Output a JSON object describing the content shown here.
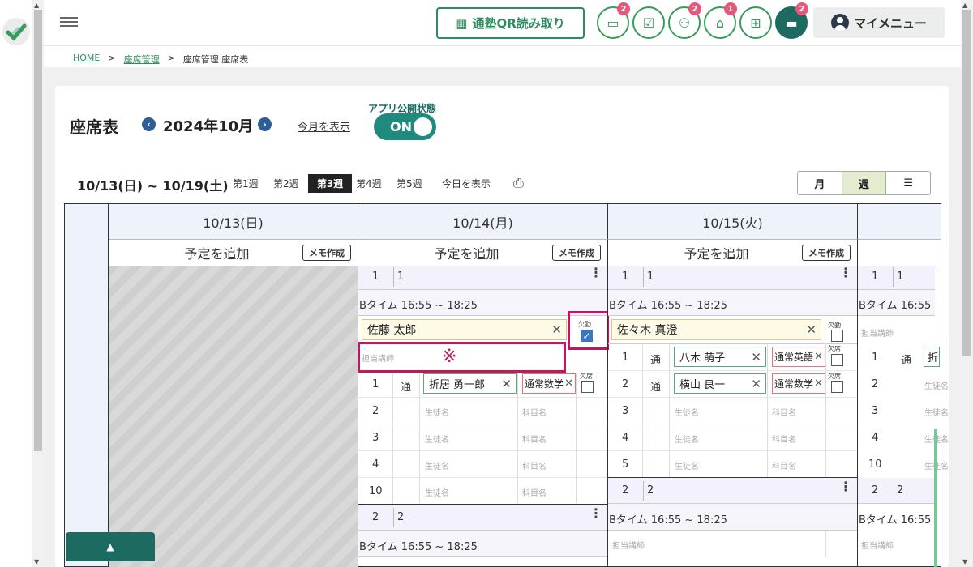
{
  "header": {
    "qr_label": "通塾QR読み取り",
    "mymenu_label": "マイメニュー",
    "badges": {
      "messages": "2",
      "students": "2",
      "school": "1",
      "chat": "2"
    }
  },
  "breadcrumb": {
    "home": "HOME",
    "seat_mgmt": "座席管理",
    "current": "座席管理 座席表",
    "sep": ">"
  },
  "page": {
    "title": "座席表",
    "month": "2024年10月",
    "this_month": "今月を表示",
    "app_state_label": "アプリ公開状態",
    "toggle": "ON",
    "range": "10/13(日) ~ 10/19(土)",
    "weeks": [
      "第1週",
      "第2週",
      "第3週",
      "第4週",
      "第5週"
    ],
    "today": "今日を表示",
    "view": {
      "month": "月",
      "week": "週",
      "list": "☰"
    }
  },
  "days": [
    {
      "label": "10/13(日)",
      "add": "予定を追加",
      "memo": "メモ作成"
    },
    {
      "label": "10/14(月)",
      "add": "予定を追加",
      "memo": "メモ作成"
    },
    {
      "label": "10/15(火)",
      "add": "予定を追加",
      "memo": "メモ作成"
    }
  ],
  "schedule": {
    "period": "Bタイム 16:55 ~ 18:25",
    "room1": "1",
    "room2": "2",
    "absent": "欠勤",
    "absent_seat": "欠席",
    "teacher_ph": "担当講師",
    "student_ph": "生徒名",
    "subject_ph": "科目名",
    "mark": "※",
    "tsu": "通",
    "mon": {
      "teacher": "佐藤 太郎",
      "rows": [
        {
          "no": "1",
          "student": "折居 勇一郎",
          "subject": "通常数学"
        },
        {
          "no": "2"
        },
        {
          "no": "3"
        },
        {
          "no": "4"
        },
        {
          "no": "10"
        }
      ]
    },
    "tue": {
      "teacher": "佐々木 真澄",
      "rows": [
        {
          "no": "1",
          "student": "八木 萌子",
          "subject": "通常英語"
        },
        {
          "no": "2",
          "student": "横山 良一",
          "subject": "通常数学"
        },
        {
          "no": "3"
        },
        {
          "no": "4"
        },
        {
          "no": "5"
        }
      ]
    },
    "wed_rows": [
      "1",
      "2",
      "3",
      "4",
      "10"
    ],
    "wed_partial_student": "折",
    "wed_partial_period": "Bタイム 16:55"
  },
  "colors": {
    "accent": "#1d6b60",
    "green": "#2e8b5e",
    "highlight": "#c2185b",
    "badge": "#e8567a"
  }
}
